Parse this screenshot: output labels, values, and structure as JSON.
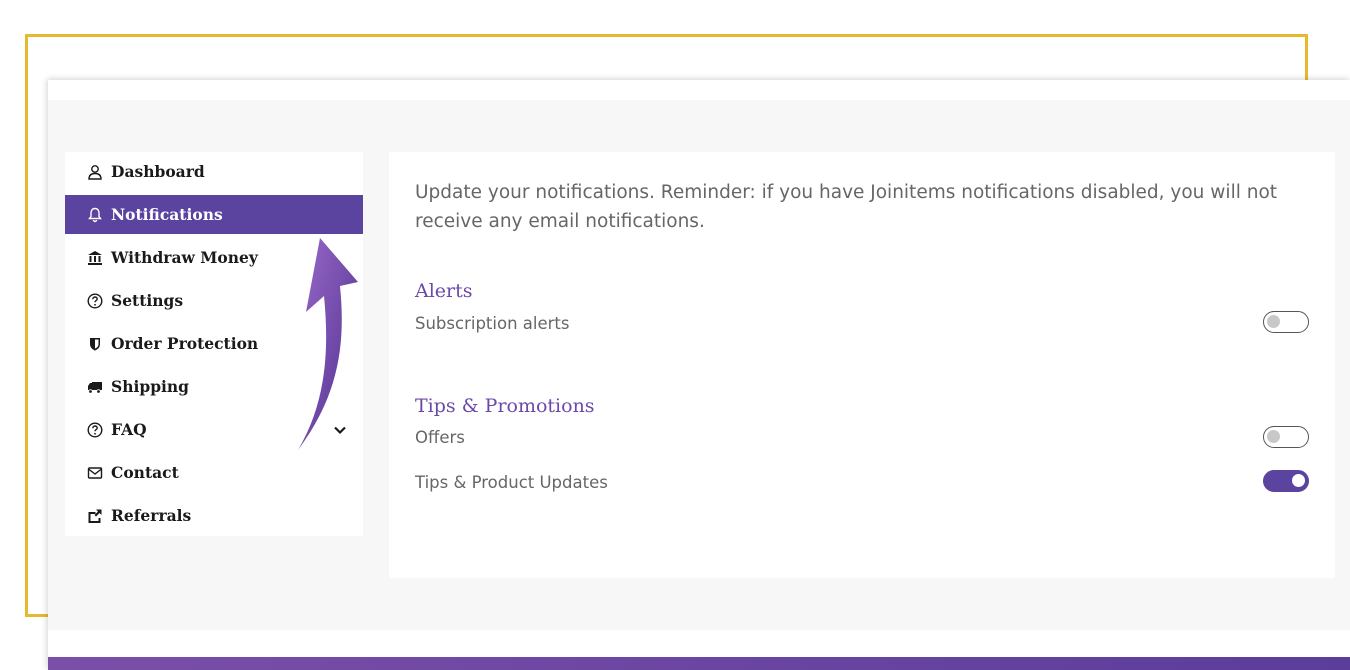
{
  "sidebar": {
    "items": [
      {
        "label": "Dashboard",
        "icon": "user-icon"
      },
      {
        "label": "Notifications",
        "icon": "bell-icon",
        "active": true
      },
      {
        "label": "Withdraw Money",
        "icon": "bank-icon"
      },
      {
        "label": "Settings",
        "icon": "question-circle-icon"
      },
      {
        "label": "Order Protection",
        "icon": "shield-icon"
      },
      {
        "label": "Shipping",
        "icon": "truck-icon"
      },
      {
        "label": "FAQ",
        "icon": "question-circle-icon",
        "has_dropdown": true
      },
      {
        "label": "Contact",
        "icon": "envelope-icon"
      },
      {
        "label": "Referrals",
        "icon": "share-icon"
      }
    ]
  },
  "content": {
    "intro": "Update your notifications. Reminder: if you have Joinitems notifications disabled, you will not receive any email notifications.",
    "sections": [
      {
        "title": "Alerts",
        "options": [
          {
            "label": "Subscription alerts",
            "enabled": false
          }
        ]
      },
      {
        "title": "Tips & Promotions",
        "options": [
          {
            "label": "Offers",
            "enabled": false
          },
          {
            "label": "Tips & Product Updates",
            "enabled": true
          }
        ]
      }
    ]
  },
  "colors": {
    "accent": "#5b43a0",
    "frame": "#e6b92e",
    "heading": "#6a4aa8",
    "arrow": "#7a4fb0"
  }
}
